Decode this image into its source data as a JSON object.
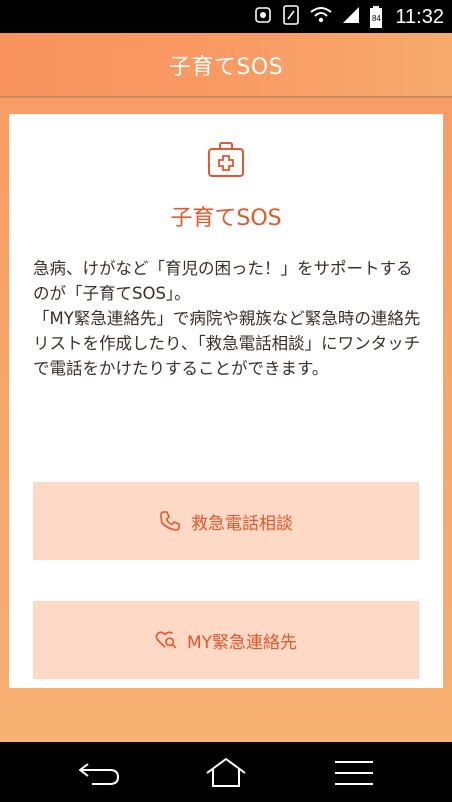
{
  "status_bar": {
    "battery_level": "84",
    "time": "11:32"
  },
  "header": {
    "title": "子育てSOS"
  },
  "card": {
    "icon": "first-aid-kit-icon",
    "title": "子育てSOS",
    "description": "急病、けがなど「育児の困った！」をサポートするのが「子育てSOS」。\n「MY緊急連絡先」で病院や親族など緊急時の連絡先リストを作成したり、「救急電話相談」にワンタッチで電話をかけたりすることができます。"
  },
  "buttons": {
    "emergency_consult": {
      "label": "救急電話相談",
      "icon": "phone-icon"
    },
    "my_emergency_contacts": {
      "label": "MY緊急連絡先",
      "icon": "heart-search-icon"
    }
  },
  "colors": {
    "accent": "#e2582b",
    "header_bg": "#f99a63",
    "button_bg": "#fdd9c6",
    "text": "#3a2e2a"
  },
  "nav_bar": {
    "back_icon": "back-icon",
    "home_icon": "home-icon",
    "menu_icon": "menu-icon"
  }
}
